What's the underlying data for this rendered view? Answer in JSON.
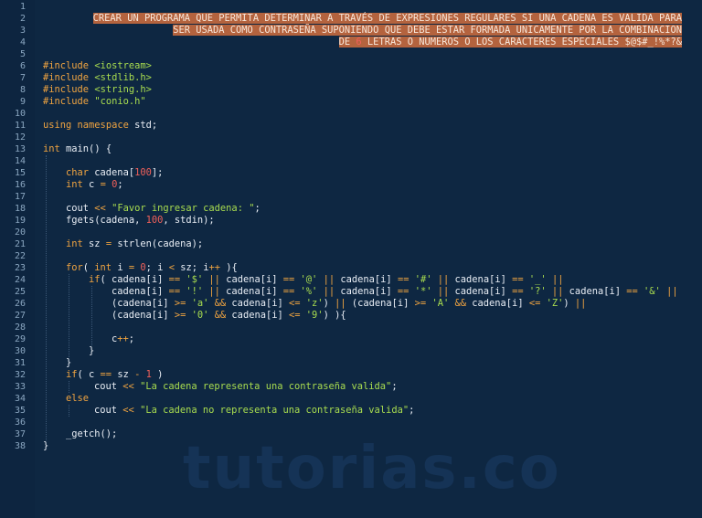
{
  "comment": {
    "line1": "CREAR UN PROGRAMA QUE PERMITA DETERMINAR A TRAVÉS DE EXPRESIONES REGULARES SI UNA CADENA ES VALIDA PARA",
    "line2": "SER USADA COMO CONTRASEÑA SUPONIENDO QUE DEBE ESTAR FORMADA UNICAMENTE POR LA COMBINACION",
    "line3_a": "DE ",
    "line3_num": "6",
    "line3_b": " LETRAS O NUMEROS O LOS CARACTERES ESPECIALES ",
    "line3_special": "$@$#_!%*?&"
  },
  "line_numbers": [
    "1",
    "2",
    "3",
    "4",
    "5",
    "6",
    "7",
    "8",
    "9",
    "10",
    "11",
    "12",
    "13",
    "14",
    "15",
    "16",
    "17",
    "18",
    "19",
    "20",
    "21",
    "22",
    "23",
    "24",
    "25",
    "26",
    "27",
    "28",
    "29",
    "30",
    "31",
    "32",
    "33",
    "34",
    "35",
    "36",
    "37",
    "38"
  ],
  "code": {
    "l6_a": "#include ",
    "l6_b": "<iostream>",
    "l7_a": "#include ",
    "l7_b": "<stdlib.h>",
    "l8_a": "#include ",
    "l8_b": "<string.h>",
    "l9_a": "#include ",
    "l9_b": "\"conio.h\"",
    "l11_a": "using namespace",
    "l11_b": " std;",
    "l13_a": "int",
    "l13_b": " main() {",
    "l15_a": "char",
    "l15_b": " cadena[",
    "l15_c": "100",
    "l15_d": "];",
    "l16_a": "int",
    "l16_b": " c ",
    "l16_c": "=",
    "l16_d": " ",
    "l16_e": "0",
    "l16_f": ";",
    "l18_a": "cout ",
    "l18_b": "<<",
    "l18_c": " ",
    "l18_d": "\"Favor ingresar cadena: \"",
    "l18_e": ";",
    "l19_a": "fgets(cadena, ",
    "l19_b": "100",
    "l19_c": ", stdin);",
    "l21_a": "int",
    "l21_b": " sz ",
    "l21_c": "=",
    "l21_d": " strlen(cadena);",
    "l23_a": "for",
    "l23_b": "( ",
    "l23_c": "int",
    "l23_d": " i ",
    "l23_e": "=",
    "l23_f": " ",
    "l23_g": "0",
    "l23_h": "; i ",
    "l23_i": "<",
    "l23_j": " sz; i",
    "l23_k": "++",
    "l23_l": " ){",
    "l24": [
      "if",
      "( cadena[i] ",
      "==",
      " ",
      "'$'",
      " ",
      "||",
      " cadena[i] ",
      "==",
      " ",
      "'@'",
      " ",
      "||",
      " cadena[i] ",
      "==",
      " ",
      "'#'",
      " ",
      "||",
      " cadena[i] ",
      "==",
      " ",
      "'_'",
      " ",
      "||"
    ],
    "l25": [
      "cadena[i] ",
      "==",
      " ",
      "'!'",
      " ",
      "||",
      " cadena[i] ",
      "==",
      " ",
      "'%'",
      " ",
      "||",
      " cadena[i] ",
      "==",
      " ",
      "'*'",
      " ",
      "||",
      " cadena[i] ",
      "==",
      " ",
      "'?'",
      " ",
      "||",
      " cadena[i] ",
      "==",
      " ",
      "'&'",
      " ",
      "||"
    ],
    "l26": [
      "(cadena[i] ",
      ">=",
      " ",
      "'a'",
      " ",
      "&&",
      " cadena[i] ",
      "<=",
      " ",
      "'z'",
      ") ",
      "||",
      " (cadena[i] ",
      ">=",
      " ",
      "'A'",
      " ",
      "&&",
      " cadena[i] ",
      "<=",
      " ",
      "'Z'",
      ") ",
      "||"
    ],
    "l27": [
      "(cadena[i] ",
      ">=",
      " ",
      "'0'",
      " ",
      "&&",
      " cadena[i] ",
      "<=",
      " ",
      "'9'",
      ") ){"
    ],
    "l29_a": "c",
    "l29_b": "++",
    "l29_c": ";",
    "l30": "}",
    "l31": "}",
    "l32_a": "if",
    "l32_b": "( c ",
    "l32_c": "==",
    "l32_d": " sz ",
    "l32_e": "-",
    "l32_f": " ",
    "l32_g": "1",
    "l32_h": " )",
    "l33_a": "cout ",
    "l33_b": "<<",
    "l33_c": " ",
    "l33_d": "\"La cadena representa una contraseña valida\"",
    "l33_e": ";",
    "l34": "else",
    "l35_a": "cout ",
    "l35_b": "<<",
    "l35_c": " ",
    "l35_d": "\"La cadena no representa una contraseña valida\"",
    "l35_e": ";",
    "l37": "_getch();",
    "l38": "}"
  },
  "watermark": "tutorias.co",
  "colors": {
    "background": "#0e2742",
    "keyword": "#f0a441",
    "string": "#a9dd4f",
    "number": "#f0605a",
    "highlight": "#b4633e"
  }
}
